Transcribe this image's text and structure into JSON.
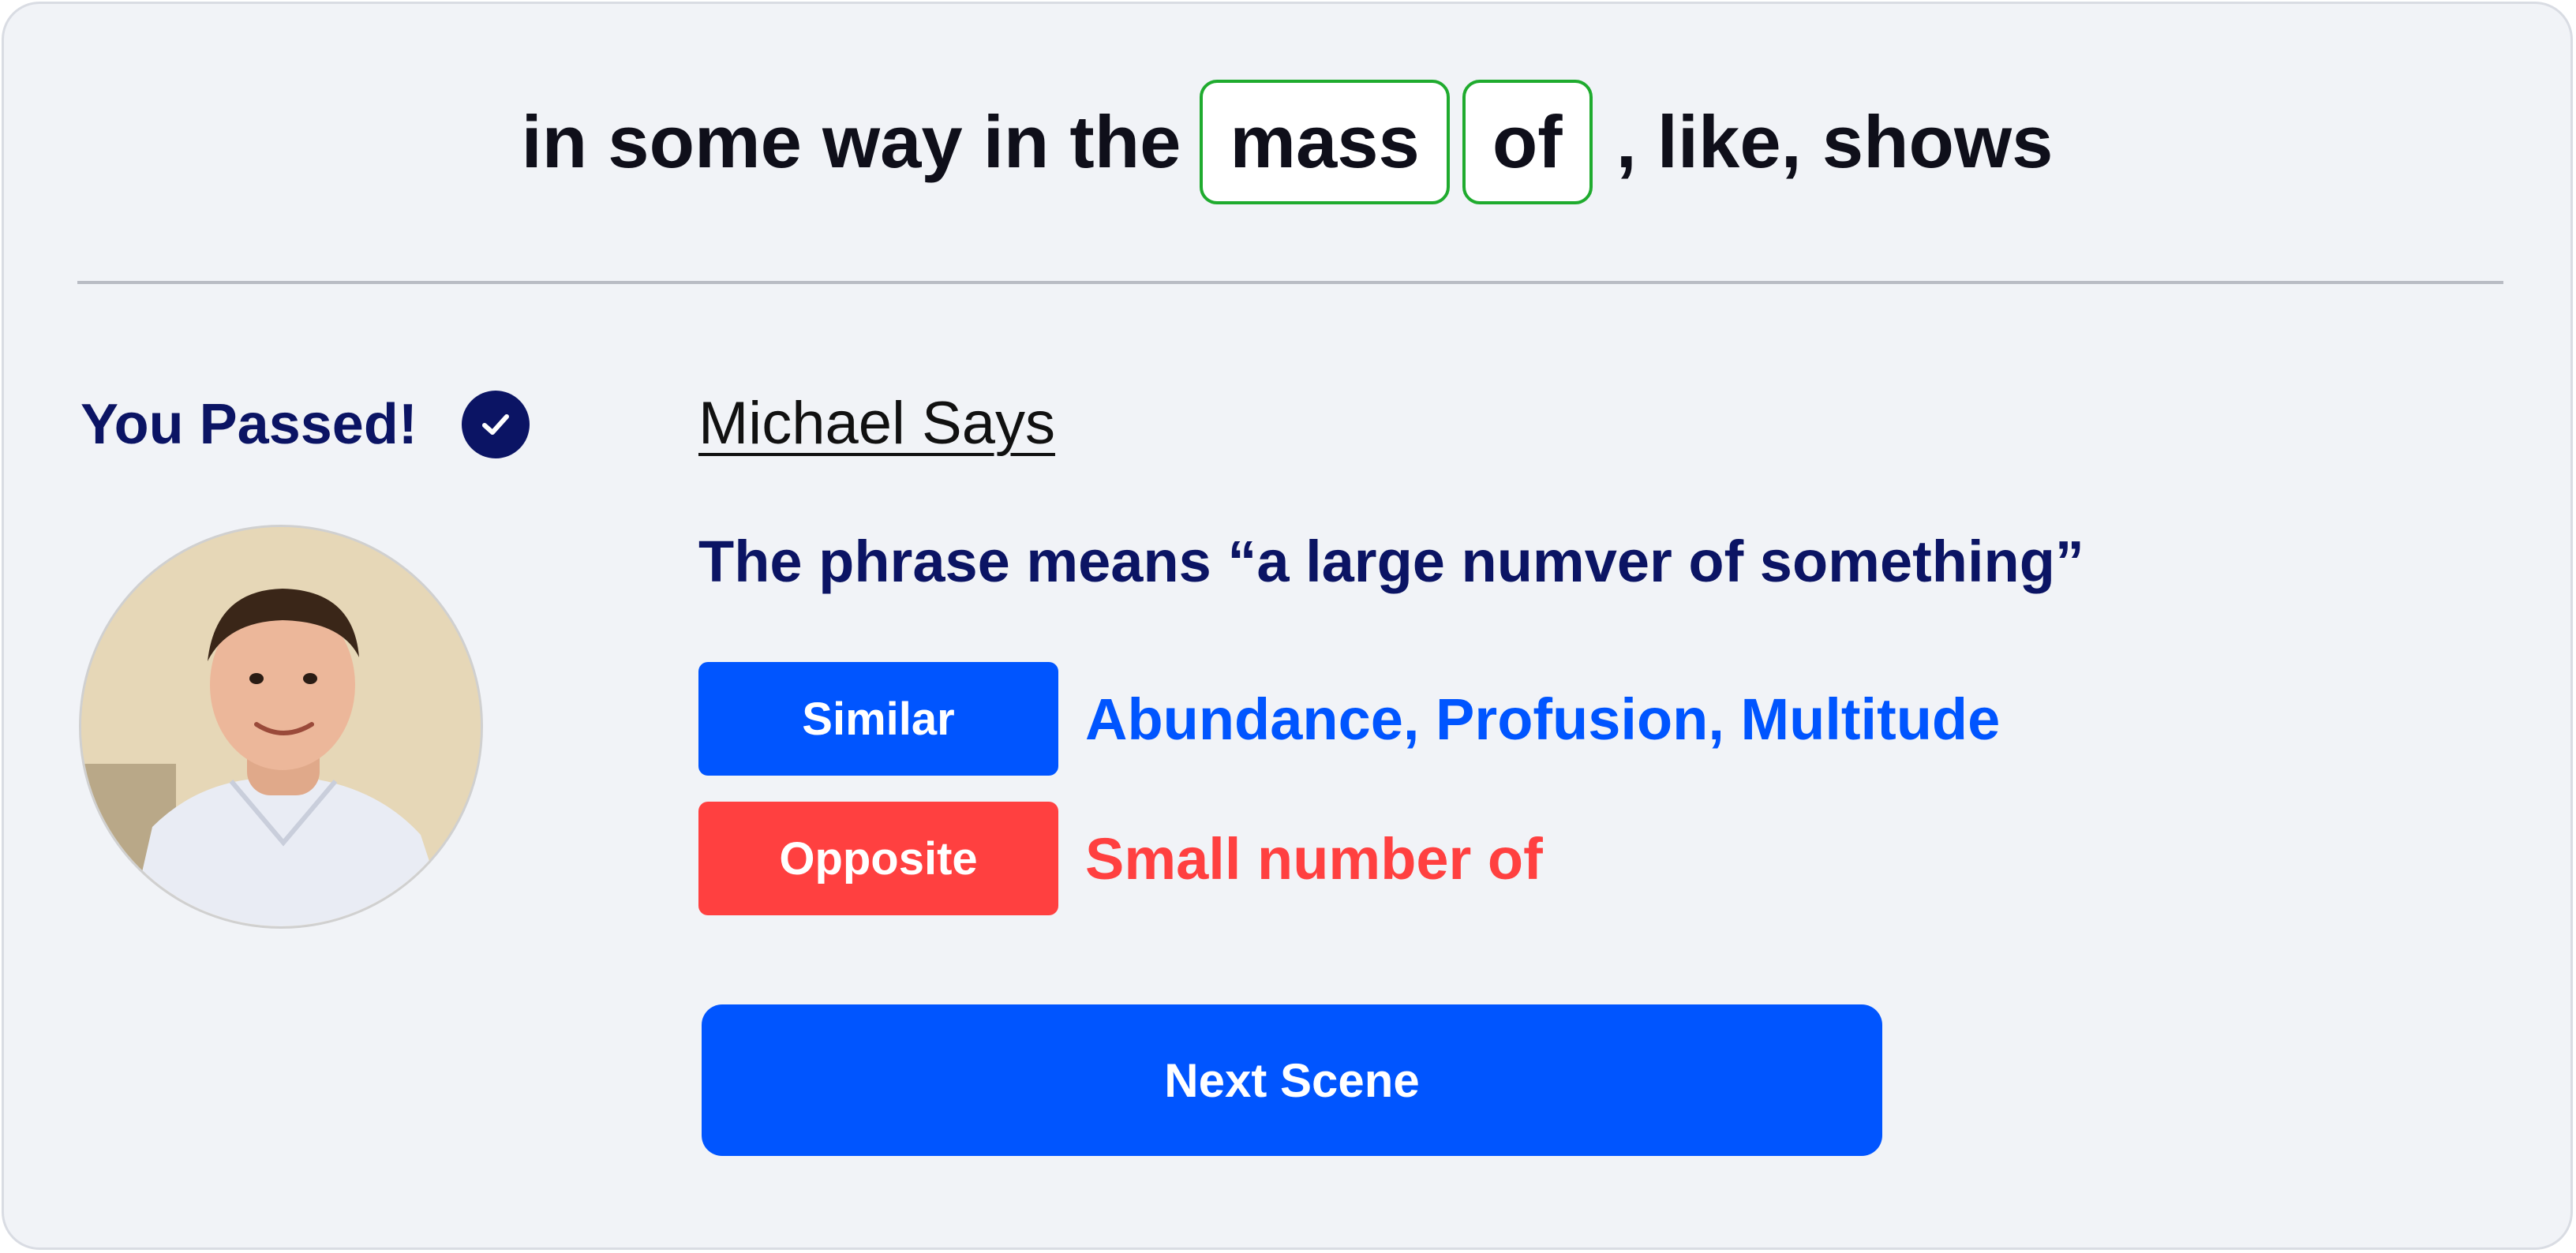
{
  "sentence": {
    "before": "in some way in the",
    "highlighted": [
      "mass",
      "of"
    ],
    "after": ", like, shows"
  },
  "result": {
    "status_label": "You Passed!",
    "status_icon": "check-circle-icon"
  },
  "explanation": {
    "speaker_label": "Michael Says",
    "meaning": "The phrase means “a large numver of something”",
    "similar": {
      "tag_label": "Similar",
      "words": "Abundance, Profusion, Multitude"
    },
    "opposite": {
      "tag_label": "Opposite",
      "words": "Small number of"
    }
  },
  "actions": {
    "next_label": "Next Scene"
  },
  "colors": {
    "highlight_border": "#1fab2e",
    "navy": "#0b1464",
    "similar": "#0055ff",
    "opposite": "#ff4040",
    "primary_button": "#0055ff"
  }
}
